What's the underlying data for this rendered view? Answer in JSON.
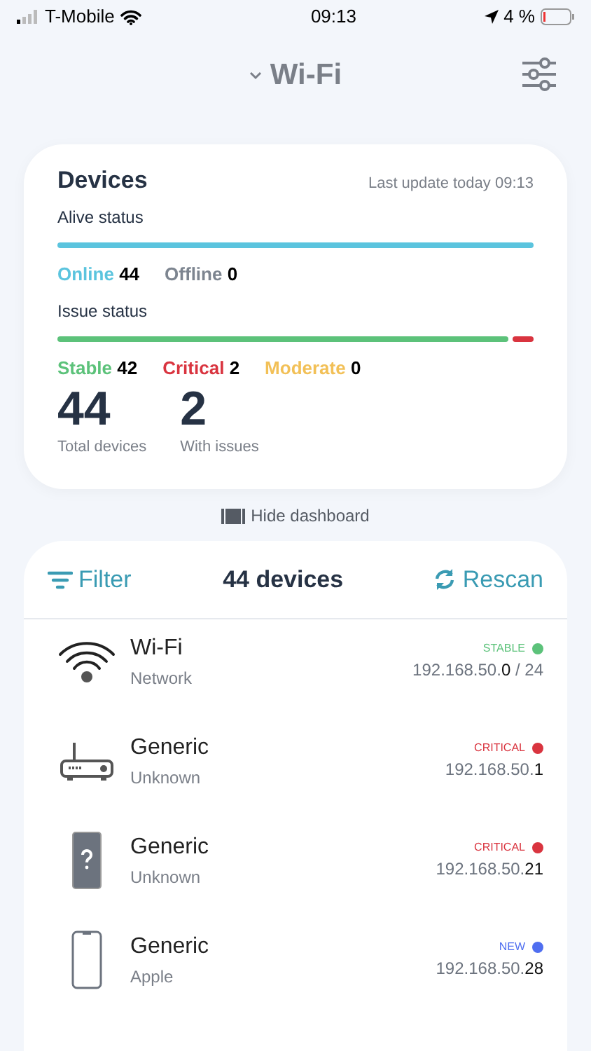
{
  "status_bar": {
    "carrier": "T-Mobile",
    "time": "09:13",
    "battery": "4 %"
  },
  "header": {
    "title": "Wi-Fi"
  },
  "dashboard": {
    "title": "Devices",
    "last_update": "Last update today 09:13",
    "alive": {
      "label": "Alive status",
      "legend": [
        {
          "label": "Online",
          "count": "44",
          "color": "#5bc4de"
        },
        {
          "label": "Offline",
          "count": "0",
          "color": "#7d8590"
        }
      ]
    },
    "issues": {
      "label": "Issue status",
      "legend": [
        {
          "label": "Stable",
          "count": "42",
          "color": "#5cc27a"
        },
        {
          "label": "Critical",
          "count": "2",
          "color": "#d9343f"
        },
        {
          "label": "Moderate",
          "count": "0",
          "color": "#f2c057"
        }
      ]
    },
    "totals": [
      {
        "value": "44",
        "label": "Total devices"
      },
      {
        "value": "2",
        "label": "With issues"
      }
    ],
    "hide_label": "Hide dashboard"
  },
  "list": {
    "filter": "Filter",
    "count": "44 devices",
    "rescan": "Rescan",
    "devices": [
      {
        "kind": "wifi",
        "name": "Wi-Fi",
        "vendor": "Network",
        "status": "STABLE",
        "color": "#5cc27a",
        "ip": "192.168.50.**0** / 24"
      },
      {
        "kind": "router",
        "name": "Generic",
        "vendor": "Unknown",
        "status": "CRITICAL",
        "color": "#d9343f",
        "ip": "192.168.50.**1**"
      },
      {
        "kind": "unknown",
        "name": "Generic",
        "vendor": "Unknown",
        "status": "CRITICAL",
        "color": "#d9343f",
        "ip": "192.168.50.**21**"
      },
      {
        "kind": "phone",
        "name": "Generic",
        "vendor": "Apple",
        "status": "NEW",
        "color": "#4f6ef0",
        "ip": "192.168.50.**28**"
      }
    ]
  }
}
